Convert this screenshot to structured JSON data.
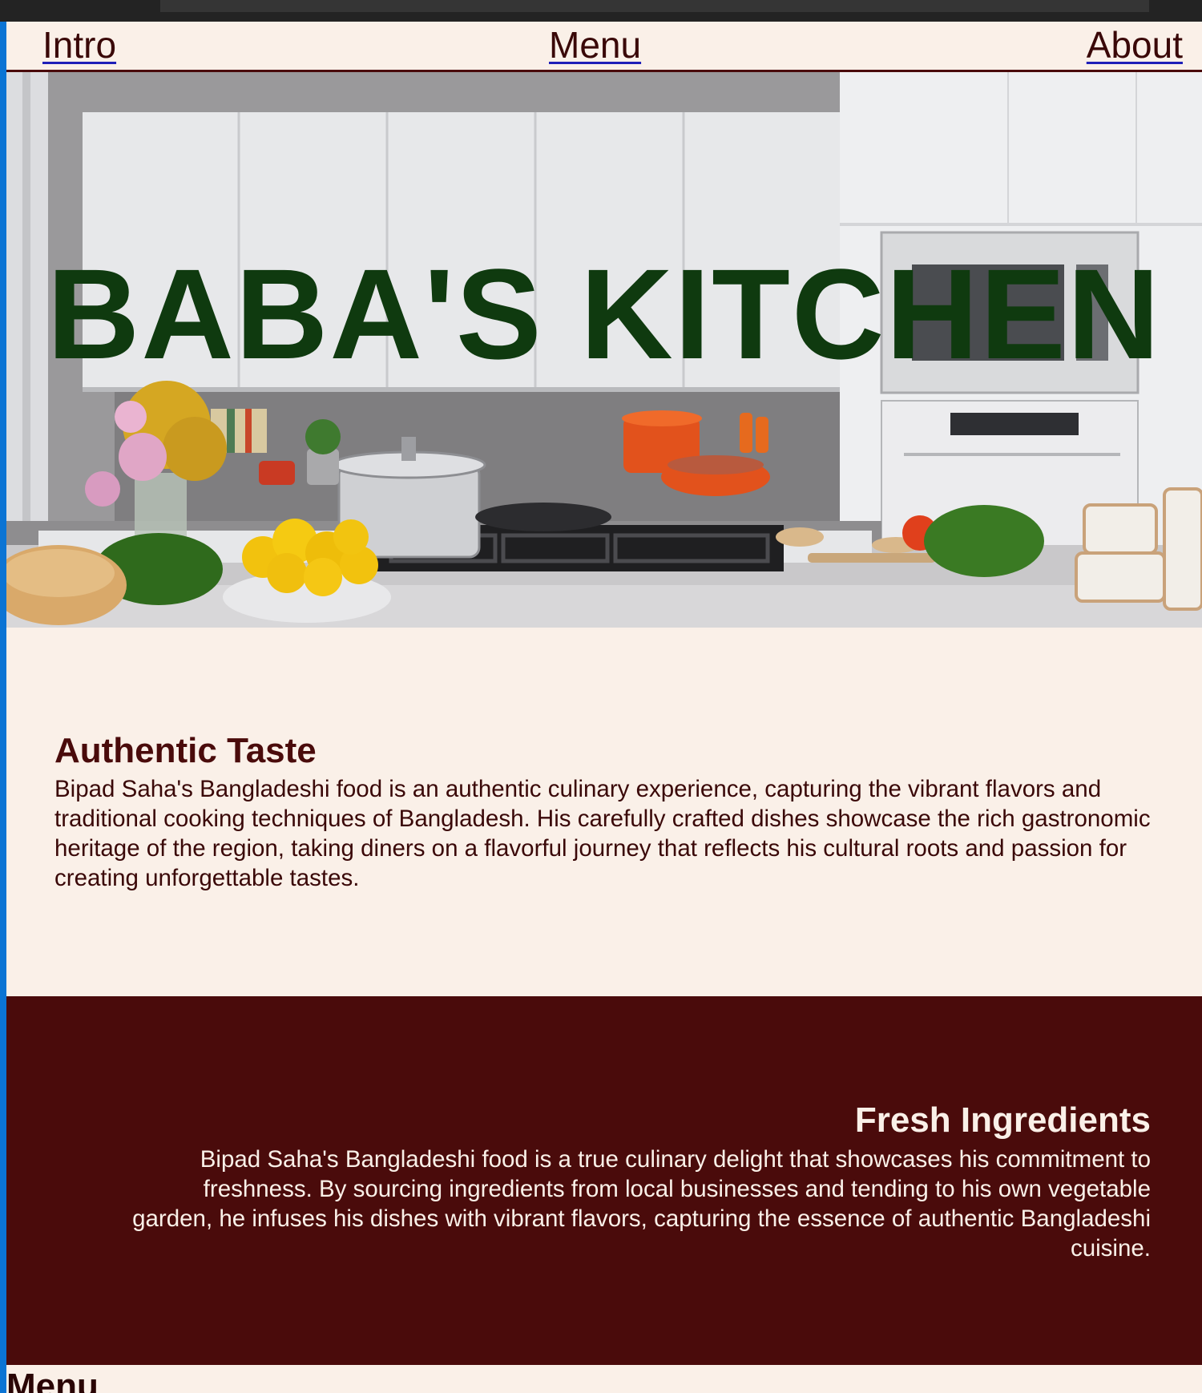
{
  "nav": {
    "intro": "Intro",
    "menu": "Menu",
    "about": "About"
  },
  "hero": {
    "title": "BABA'S KITCHEN"
  },
  "section1": {
    "heading": "Authentic Taste",
    "body": "Bipad Saha's Bangladeshi food is an authentic culinary experience, capturing the vibrant flavors and traditional cooking techniques of Bangladesh. His carefully crafted dishes showcase the rich gastronomic heritage of the region, taking diners on a flavorful journey that reflects his cultural roots and passion for creating unforgettable tastes."
  },
  "section2": {
    "heading": "Fresh Ingredients",
    "body": "Bipad Saha's Bangladeshi food is a true culinary delight that showcases his commitment to freshness. By sourcing ingredients from local businesses and tending to his own vegetable garden, he infuses his dishes with vibrant flavors, capturing the essence of authentic Bangladeshi cuisine."
  },
  "menu_section": {
    "heading": "Menu"
  },
  "colors": {
    "background": "#faf0e8",
    "maroon": "#4a0b0b",
    "title_green": "#0f3a0f",
    "accent_blue": "#0b74d4"
  }
}
